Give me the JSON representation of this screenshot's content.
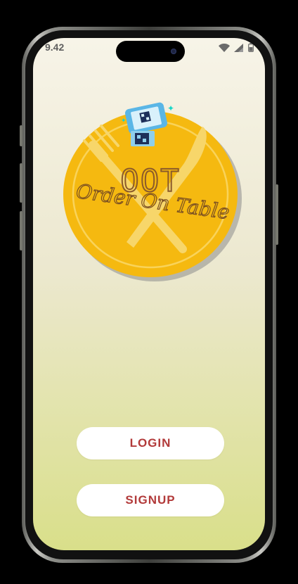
{
  "status_bar": {
    "time": "9.42",
    "icons": [
      "wifi-icon",
      "signal-icon",
      "battery-icon"
    ]
  },
  "logo": {
    "title": "OOT",
    "tagline": "Order On Table",
    "colors": {
      "plate": "#f5b910",
      "cutlery": "#f7d66a",
      "accent": "#8a5a2b"
    }
  },
  "actions": {
    "login_label": "LOGIN",
    "signup_label": "SIGNUP"
  },
  "colors": {
    "button_text": "#b23a3a",
    "button_bg": "#ffffff",
    "background_top": "#f7f4e8",
    "background_bottom": "#d9df8a"
  }
}
